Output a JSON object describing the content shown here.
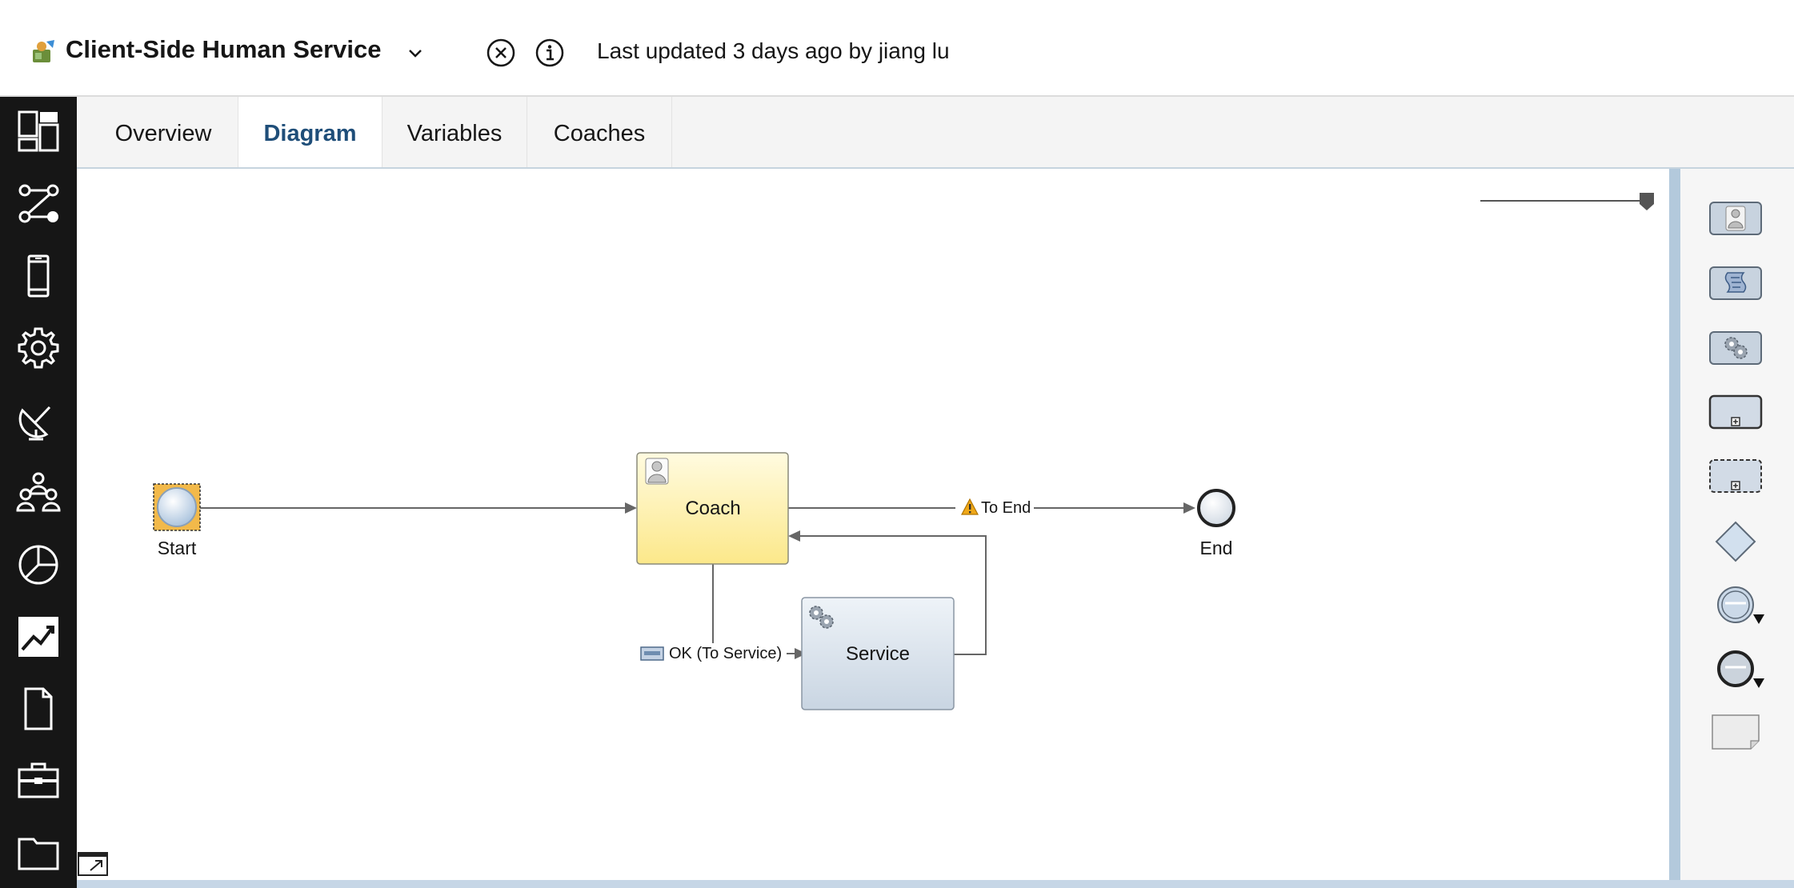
{
  "header": {
    "title": "Client-Side Human Service",
    "last_updated": "Last updated 3 days ago by jiang lu"
  },
  "rail": {
    "items": [
      {
        "icon": "dashboard-icon"
      },
      {
        "icon": "process-flow-icon"
      },
      {
        "icon": "mobile-device-icon"
      },
      {
        "icon": "gear-icon"
      },
      {
        "icon": "satellite-dish-icon"
      },
      {
        "icon": "team-icon"
      },
      {
        "icon": "pie-chart-icon"
      },
      {
        "icon": "trend-chart-icon"
      },
      {
        "icon": "document-icon"
      },
      {
        "icon": "toolbox-icon"
      },
      {
        "icon": "folder-icon"
      }
    ]
  },
  "tabs": [
    {
      "label": "Overview",
      "active": false
    },
    {
      "label": "Diagram",
      "active": true
    },
    {
      "label": "Variables",
      "active": false
    },
    {
      "label": "Coaches",
      "active": false
    }
  ],
  "diagram": {
    "nodes": {
      "start": "Start",
      "coach": "Coach",
      "service": "Service",
      "end": "End"
    },
    "flows": {
      "to_end": "To End",
      "ok_to_service": "OK (To Service)"
    }
  },
  "palette": {
    "items": [
      {
        "icon": "user-task-icon"
      },
      {
        "icon": "script-task-icon"
      },
      {
        "icon": "service-task-icon"
      },
      {
        "icon": "subprocess-icon"
      },
      {
        "icon": "event-subprocess-icon"
      },
      {
        "icon": "gateway-icon"
      },
      {
        "icon": "intermediate-event-icon"
      },
      {
        "icon": "end-event-icon"
      },
      {
        "icon": "note-icon"
      }
    ]
  },
  "colors": {
    "rail_bg": "#161616",
    "active_tab": "#1f4e79",
    "coach_fill": "#fdeba0",
    "service_fill": "#d6dfe9"
  }
}
